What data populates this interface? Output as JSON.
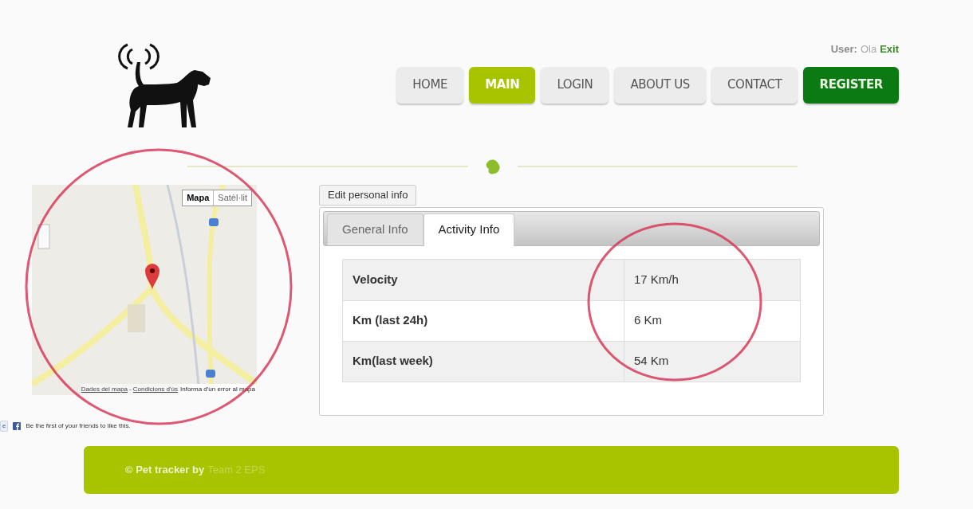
{
  "user": {
    "label": "User:",
    "name": "Ola",
    "exit": "Exit"
  },
  "nav": [
    {
      "label": "HOME",
      "kind": "plain",
      "selected": false
    },
    {
      "label": "MAIN",
      "kind": "plain",
      "selected": true
    },
    {
      "label": "LOGIN",
      "kind": "plain",
      "selected": false
    },
    {
      "label": "ABOUT US",
      "kind": "plain",
      "selected": false
    },
    {
      "label": "CONTACT",
      "kind": "plain",
      "selected": false
    },
    {
      "label": "REGISTER",
      "kind": "register",
      "selected": false
    }
  ],
  "map": {
    "types": [
      {
        "label": "Mapa",
        "selected": true
      },
      {
        "label": "Satèl·lit",
        "selected": false
      }
    ],
    "footer_links": [
      "Dades del mapa",
      "Condicions d'ús"
    ],
    "separator": "-",
    "report": "Informa d'un error al mapa"
  },
  "like": {
    "button": "e",
    "text": "Be the first of your friends to like this."
  },
  "edit_button": "Edit personal info",
  "tabs": [
    {
      "label": "General Info",
      "selected": false
    },
    {
      "label": "Activity Info",
      "selected": true
    }
  ],
  "table": {
    "rows": [
      {
        "label": "Velocity",
        "value": "17 Km/h"
      },
      {
        "label": "Km (last 24h)",
        "value": "6 Km"
      },
      {
        "label": "Km(last week)",
        "value": "54 Km"
      }
    ]
  },
  "footer": {
    "text": "© Pet tracker by",
    "link": "Team 2 EPS"
  }
}
